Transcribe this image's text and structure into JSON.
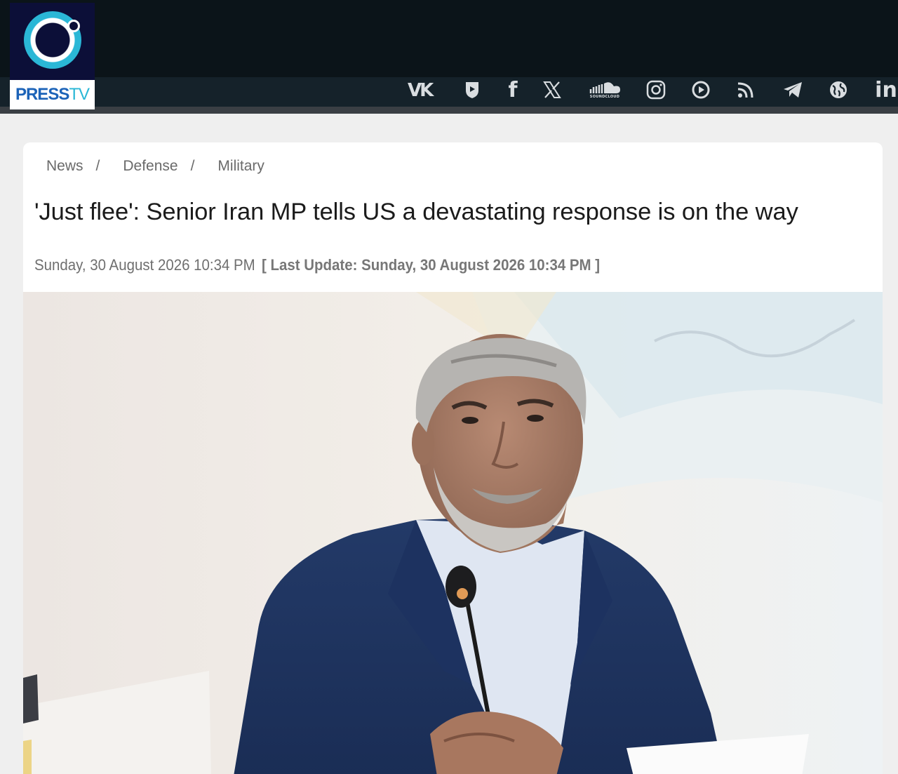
{
  "brand": {
    "logo_label": "PressTV logo",
    "logo_text_press": "PRESS",
    "logo_text_tv": "TV"
  },
  "social": [
    {
      "icon": "vk-icon",
      "label": "VK"
    },
    {
      "icon": "shield-icon",
      "label": "Odysee"
    },
    {
      "icon": "facebook-icon",
      "label": "f"
    },
    {
      "icon": "x-icon",
      "label": "X"
    },
    {
      "icon": "soundcloud-icon",
      "label": "SOUNDCLOUD"
    },
    {
      "icon": "instagram-icon",
      "label": "Instagram"
    },
    {
      "icon": "play-icon",
      "label": "Rumble"
    },
    {
      "icon": "rss-icon",
      "label": "RSS"
    },
    {
      "icon": "telegram-icon",
      "label": "Telegram"
    },
    {
      "icon": "globe-icon",
      "label": "Website"
    },
    {
      "icon": "linkedin-icon",
      "label": "in"
    }
  ],
  "breadcrumb": {
    "items": [
      "News",
      "Defense",
      "Military"
    ],
    "separator": "/"
  },
  "article": {
    "title": "'Just flee': Senior Iran MP tells US a devastating response is on the way",
    "published": "Sunday, 30 August 2026 10:34 PM",
    "last_update": "[ Last Update: Sunday, 30 August 2026 10:34 PM ]",
    "image_alt": "Senior Iranian MP in blue suit speaking at a microphone"
  },
  "colors": {
    "header_bg": "#0b1419",
    "brand_blue": "#1c63b8",
    "brand_cyan": "#2ab7d6",
    "page_bg": "#efefef"
  }
}
